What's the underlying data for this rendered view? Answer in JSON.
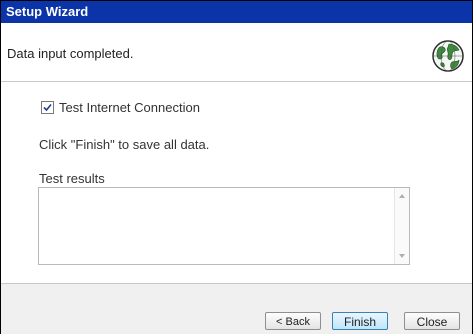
{
  "window": {
    "title": "Setup Wizard"
  },
  "header": {
    "message": "Data input completed.",
    "icon": "globe-icon"
  },
  "content": {
    "test_connection": {
      "label": "Test Internet Connection",
      "checked": true
    },
    "hint": "Click \"Finish\" to save all data.",
    "results_label": "Test results",
    "results_text": ""
  },
  "footer": {
    "back_label": "< Back",
    "finish_label": "Finish",
    "close_label": "Close"
  },
  "colors": {
    "titlebar": "#0b34a8",
    "finish_border": "#3c7fb1"
  }
}
